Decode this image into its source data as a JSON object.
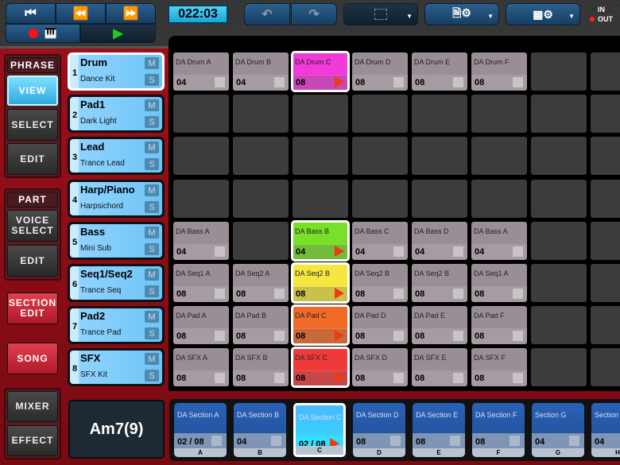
{
  "transport": {
    "time": "022:03",
    "colors": {
      "record": "#ff1010",
      "play": "#22cc22"
    }
  },
  "midi": {
    "in_label": "IN",
    "out_label": "OUT"
  },
  "sidebar": {
    "phrase": "PHRASE",
    "view": "VIEW",
    "select": "SELECT",
    "edit": "EDIT",
    "part": "PART",
    "voice_select": "VOICE SELECT",
    "part_edit": "EDIT",
    "section_edit": "SECTION EDIT",
    "song": "SONG",
    "mixer": "MIXER",
    "effect": "EFFECT"
  },
  "parts": [
    {
      "num": "1",
      "name": "Drum",
      "sub": "Dance Kit"
    },
    {
      "num": "2",
      "name": "Pad1",
      "sub": "Dark Light"
    },
    {
      "num": "3",
      "name": "Lead",
      "sub": "Trance Lead"
    },
    {
      "num": "4",
      "name": "Harp/Piano",
      "sub": "Harpsichord"
    },
    {
      "num": "5",
      "name": "Bass",
      "sub": "Mini Sub"
    },
    {
      "num": "6",
      "name": "Seq1/Seq2",
      "sub": "Trance Seq"
    },
    {
      "num": "7",
      "name": "Pad2",
      "sub": "Trance Pad"
    },
    {
      "num": "8",
      "name": "SFX",
      "sub": "SFX Kit"
    }
  ],
  "mute_label": "M",
  "solo_label": "S",
  "grid": [
    [
      {
        "l": "DA Drum A",
        "n": "04"
      },
      {
        "l": "DA Drum B",
        "n": "04"
      },
      {
        "l": "DA Drum C",
        "n": "08",
        "play": "#f23ad8"
      },
      {
        "l": "DA Drum D",
        "n": "08"
      },
      {
        "l": "DA Drum E",
        "n": "08"
      },
      {
        "l": "DA Drum F",
        "n": "08"
      },
      null,
      null
    ],
    [
      null,
      null,
      null,
      null,
      null,
      null,
      null,
      null
    ],
    [
      null,
      null,
      null,
      null,
      null,
      null,
      null,
      null
    ],
    [
      null,
      null,
      null,
      null,
      null,
      null,
      null,
      null
    ],
    [
      {
        "l": "DA Bass A",
        "n": "04"
      },
      null,
      {
        "l": "DA Bass B",
        "n": "04",
        "play": "#78e028"
      },
      {
        "l": "DA Bass C",
        "n": "04"
      },
      {
        "l": "DA Bass D",
        "n": "04"
      },
      {
        "l": "DA Bass A",
        "n": "04"
      },
      null,
      null
    ],
    [
      {
        "l": "DA Seq1 A",
        "n": "08"
      },
      {
        "l": "DA Seq2 A",
        "n": "08"
      },
      {
        "l": "DA Seq2 B",
        "n": "08",
        "play": "#f5e640"
      },
      {
        "l": "DA Seq2 B",
        "n": "08"
      },
      {
        "l": "DA Seq2 B",
        "n": "08"
      },
      {
        "l": "DA Seq1 A",
        "n": "08"
      },
      null,
      null
    ],
    [
      {
        "l": "DA Pad A",
        "n": "08"
      },
      {
        "l": "DA Pad B",
        "n": "08"
      },
      {
        "l": "DA Pad C",
        "n": "08",
        "play": "#f26a28"
      },
      {
        "l": "DA Pad D",
        "n": "08"
      },
      {
        "l": "DA Pad E",
        "n": "08"
      },
      {
        "l": "DA Pad F",
        "n": "08"
      },
      null,
      null
    ],
    [
      {
        "l": "DA SFX A",
        "n": "08"
      },
      {
        "l": "DA SFX B",
        "n": "08"
      },
      {
        "l": "DA SFX C",
        "n": "08",
        "play": "#f03a3a"
      },
      {
        "l": "DA SFX D",
        "n": "08"
      },
      {
        "l": "DA SFX E",
        "n": "08"
      },
      {
        "l": "DA SFX F",
        "n": "08"
      },
      null,
      null
    ]
  ],
  "chord": "Am7(9)",
  "sections": [
    {
      "l": "DA Section A",
      "n": "02 / 08",
      "k": "A"
    },
    {
      "l": "DA Section B",
      "n": "04",
      "k": "B"
    },
    {
      "l": "DA Section C",
      "n": "02 / 08",
      "k": "C",
      "sel": true
    },
    {
      "l": "DA Section D",
      "n": "08",
      "k": "D"
    },
    {
      "l": "DA Section E",
      "n": "08",
      "k": "E"
    },
    {
      "l": "DA Section F",
      "n": "08",
      "k": "F"
    },
    {
      "l": "Section G",
      "n": "04",
      "k": "G"
    },
    {
      "l": "Section H",
      "n": "04",
      "k": "H"
    }
  ]
}
